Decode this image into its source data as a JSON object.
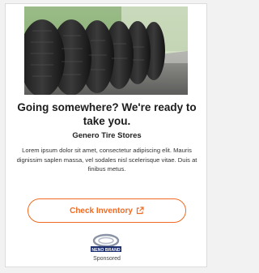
{
  "ad": {
    "headline": "Going somewhere? We're ready to take you.",
    "store_name": "Genero Tire Stores",
    "body": "Lorem ipsum dolor sit amet, consectetur adipiscing elit. Mauris dignissim saplen massa, vel sodales nisl scelerisque vitae. Duis at finibus metus.",
    "cta_label": "Check Inventory",
    "cta_icon": "external-link-icon",
    "brand_text": "NENO BRAND",
    "sponsored_label": "Sponsored",
    "image_subject": "tire-stack-photo",
    "accent_color": "#f26a21"
  }
}
